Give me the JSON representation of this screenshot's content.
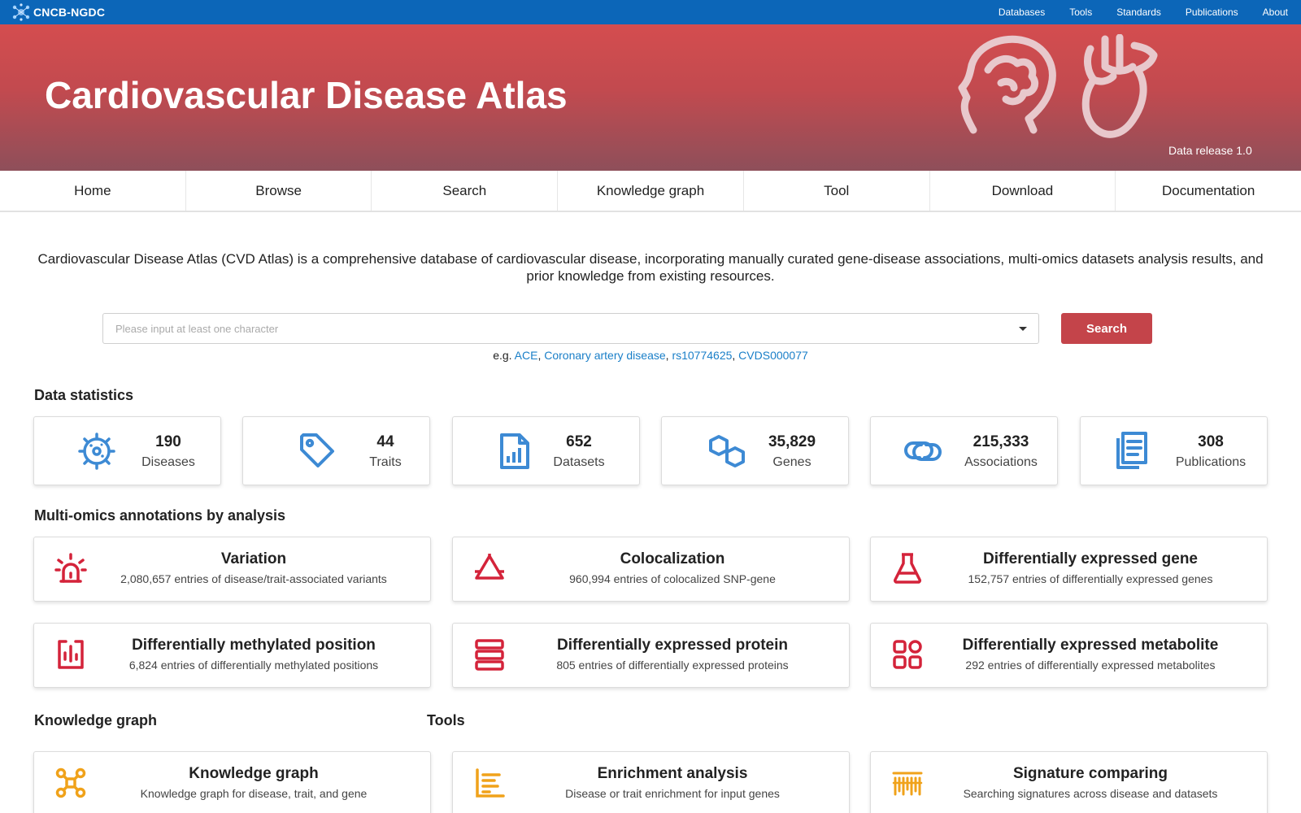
{
  "topbar": {
    "logo_text": "CNCB-NGDC",
    "nav": [
      "Databases",
      "Tools",
      "Standards",
      "Publications",
      "About"
    ]
  },
  "banner": {
    "title": "Cardiovascular Disease Atlas",
    "release": "Data release 1.0",
    "icons": [
      "brain-icon",
      "heart-icon"
    ]
  },
  "mainnav": [
    "Home",
    "Browse",
    "Search",
    "Knowledge graph",
    "Tool",
    "Download",
    "Documentation"
  ],
  "intro": "Cardiovascular Disease Atlas (CVD Atlas) is a comprehensive database of cardiovascular disease, incorporating manually curated gene-disease associations, multi-omics datasets analysis results, and prior knowledge from existing resources.",
  "search": {
    "placeholder": "Please input at least one character",
    "button": "Search",
    "examples_prefix": "e.g.",
    "examples": [
      "ACE",
      "Coronary artery disease",
      "rs10774625",
      "CVDS000077"
    ]
  },
  "sections": {
    "stats": "Data statistics",
    "multiomics": "Multi-omics annotations by analysis",
    "kg": "Knowledge graph",
    "tools": "Tools"
  },
  "stats": [
    {
      "value": "190",
      "label": "Diseases",
      "icon": "virus-icon"
    },
    {
      "value": "44",
      "label": "Traits",
      "icon": "tag-icon"
    },
    {
      "value": "652",
      "label": "Datasets",
      "icon": "file-chart-icon"
    },
    {
      "value": "35,829",
      "label": "Genes",
      "icon": "hexagon-link-icon"
    },
    {
      "value": "215,333",
      "label": "Associations",
      "icon": "link-icon"
    },
    {
      "value": "308",
      "label": "Publications",
      "icon": "documents-icon"
    }
  ],
  "analyses": [
    {
      "title": "Variation",
      "desc": "2,080,657 entries of disease/trait-associated variants",
      "icon": "siren-icon"
    },
    {
      "title": "Colocalization",
      "desc": "960,994 entries of colocalized SNP-gene",
      "icon": "triangle-nodes-icon"
    },
    {
      "title": "Differentially expressed gene",
      "desc": "152,757 entries of differentially expressed genes",
      "icon": "flask-icon"
    },
    {
      "title": "Differentially methylated position",
      "desc": "6,824 entries of differentially methylated positions",
      "icon": "bar-box-icon"
    },
    {
      "title": "Differentially expressed protein",
      "desc": "805 entries of differentially expressed proteins",
      "icon": "stack-icon"
    },
    {
      "title": "Differentially expressed metabolite",
      "desc": "292 entries of differentially expressed metabolites",
      "icon": "grid-icon"
    }
  ],
  "tools": [
    {
      "title": "Knowledge graph",
      "desc": "Knowledge graph for disease, trait, and gene",
      "icon": "graph-nodes-icon"
    },
    {
      "title": "Enrichment analysis",
      "desc": "Disease or trait enrichment for input genes",
      "icon": "bar-chart-icon"
    },
    {
      "title": "Signature comparing",
      "desc": "Searching signatures across disease and datasets",
      "icon": "barcode-icon"
    }
  ],
  "colors": {
    "topbar": "#0c66b8",
    "banner_top": "#d44d4f",
    "banner_bottom": "#8e4f5a",
    "search_button": "#c4444a",
    "stat_icon": "#3d8ad4",
    "analysis_icon": "#d4233a",
    "tool_icon": "#f0a21a",
    "link": "#1a7fc8"
  }
}
